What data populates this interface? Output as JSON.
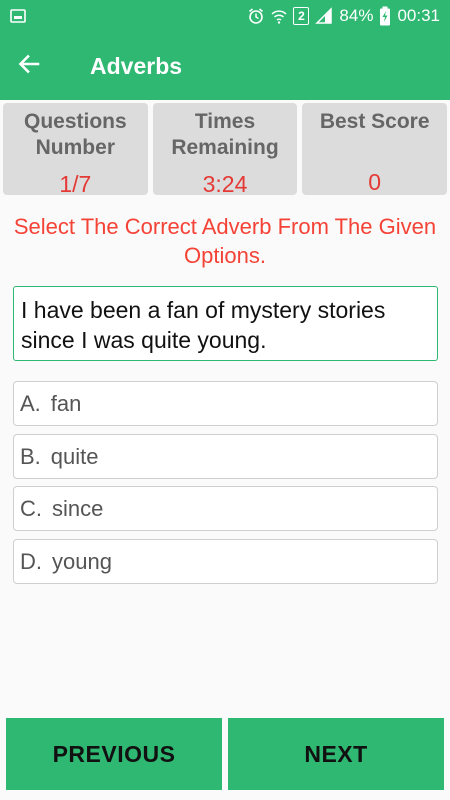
{
  "status_bar": {
    "battery": "84%",
    "time": "00:31",
    "sim_number": "2",
    "icons": [
      "screenshot-icon",
      "alarm-icon",
      "wifi-icon",
      "sim-icon",
      "signal-icon",
      "battery-charging-icon"
    ]
  },
  "toolbar": {
    "title": "Adverbs",
    "back_icon": "arrow-left-icon"
  },
  "stats": [
    {
      "label": "Questions\nNumber",
      "value": "1/7"
    },
    {
      "label": "Times\nRemaining",
      "value": "3:24"
    },
    {
      "label": "Best Score",
      "value": "0"
    }
  ],
  "instruction": "Select The Correct Adverb From The Given Options.",
  "question": "I have been a fan of mystery stories since I was quite young.",
  "options": [
    {
      "letter": "A.",
      "text": "fan"
    },
    {
      "letter": "B.",
      "text": "quite"
    },
    {
      "letter": "C.",
      "text": "since"
    },
    {
      "letter": "D.",
      "text": "young"
    }
  ],
  "buttons": {
    "previous": "PREVIOUS",
    "next": "NEXT"
  },
  "colors": {
    "primary": "#2eb872",
    "accent_red": "#f44336",
    "stat_bg": "#dcdcdc"
  }
}
